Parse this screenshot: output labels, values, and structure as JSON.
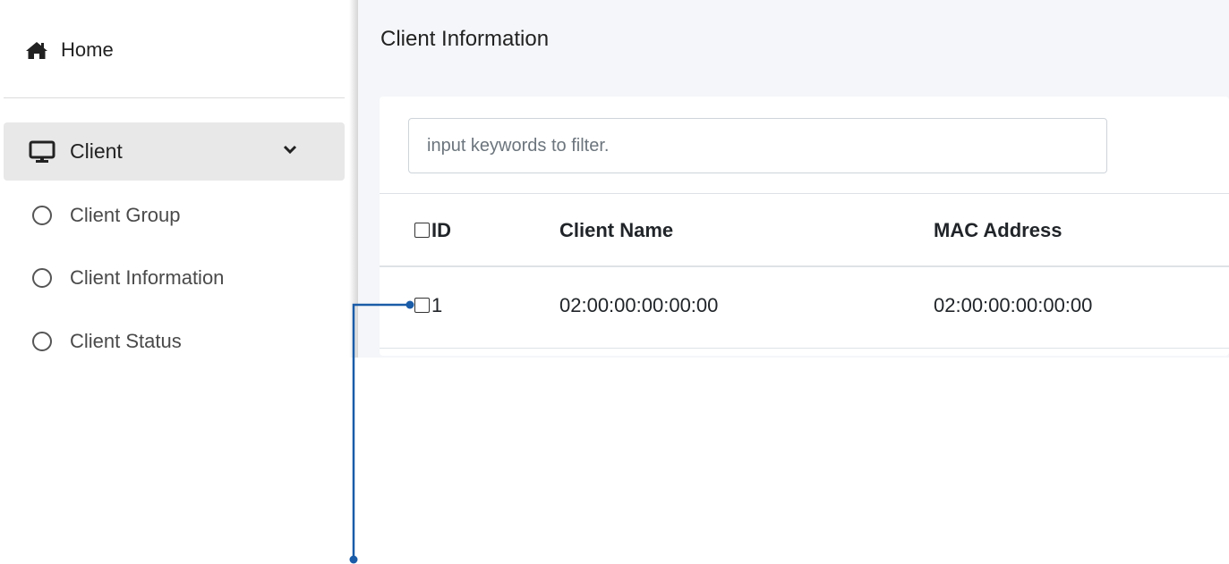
{
  "sidebar": {
    "home_label": "Home",
    "client_label": "Client",
    "items": [
      {
        "label": "Client Group"
      },
      {
        "label": "Client Information"
      },
      {
        "label": "Client Status"
      }
    ]
  },
  "header": {
    "title": "Client Information"
  },
  "filter": {
    "placeholder": "input keywords to filter."
  },
  "table": {
    "columns": [
      "ID",
      "Client Name",
      "MAC Address"
    ],
    "rows": [
      {
        "id": "1",
        "client_name": "02:00:00:00:00:00",
        "mac": "02:00:00:00:00:00"
      }
    ]
  },
  "colors": {
    "annotation": "#1a5ca8",
    "active_bg": "#e8e8e8",
    "header_bg": "#f4f6f9"
  }
}
